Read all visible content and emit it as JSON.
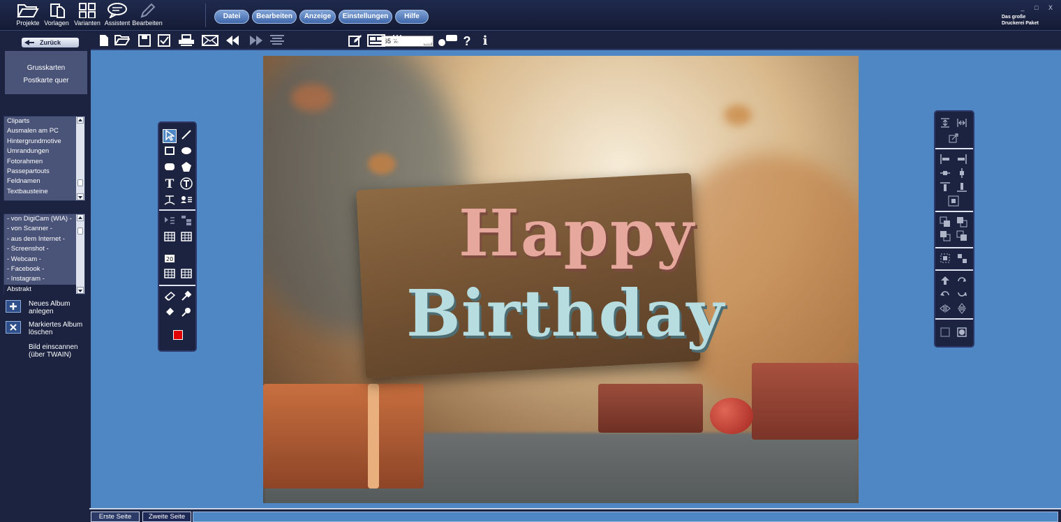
{
  "modes": [
    {
      "label": "Projekte",
      "icon": "folder-open-icon"
    },
    {
      "label": "Vorlagen",
      "icon": "pages-icon"
    },
    {
      "label": "Varianten",
      "icon": "grid-icon"
    },
    {
      "label": "Assistent",
      "icon": "speech-bubble-icon"
    },
    {
      "label": "Bearbeiten",
      "icon": "pencil-icon"
    }
  ],
  "menu": [
    "Datei",
    "Bearbeiten",
    "Anzeige",
    "Einstellungen",
    "Hilfe"
  ],
  "brand": {
    "line1": "Das große",
    "line2": "Druckerei Paket"
  },
  "window_controls": "_ □ X",
  "back_button": "Zurück",
  "category": {
    "line1": "Grusskarten",
    "line2": "Postkarte quer"
  },
  "clipart_list": [
    "Cliparts",
    "Ausmalen am PC",
    "Hintergrundmotive",
    "Umrandungen",
    "Fotorahmen",
    "Passepartouts",
    "Feldnamen",
    "Textbausteine"
  ],
  "source_list": [
    "- von DigiCam (WIA) -",
    "- von Scanner -",
    "- aus dem Internet -",
    "- Screenshot -",
    "- Webcam -",
    "- Facebook -",
    "- Instagram -",
    "Abstrakt"
  ],
  "album_actions": [
    {
      "label": "Neues Album anlegen",
      "icon": "new-album-icon"
    },
    {
      "label": "Markiertes Album löschen",
      "icon": "delete-album-icon"
    },
    {
      "label": "Bild einscannen (über TWAIN)",
      "icon": ""
    }
  ],
  "zoom": "65 %",
  "photo_text": {
    "line1": "Happy",
    "line2": "Birthday"
  },
  "page_tabs": [
    "Erste Seite",
    "Zweite Seite"
  ],
  "colors": {
    "accent": "#4f87c4",
    "panel": "#1b2340",
    "current_color": "#e00000"
  }
}
